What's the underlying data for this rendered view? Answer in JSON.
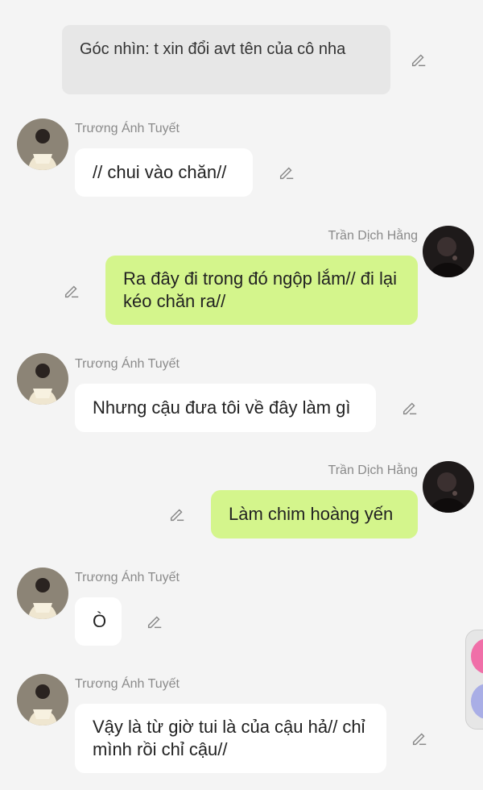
{
  "narration": {
    "text": "Góc nhìn: t xin đổi avt tên của cô nha"
  },
  "messages": [
    {
      "sender": "Trương Ánh Tuyết",
      "text": "// chui vào chăn//"
    },
    {
      "sender": "Trần Dịch Hằng",
      "text": "Ra đây đi trong đó ngộp lắm// đi lại kéo chăn ra//"
    },
    {
      "sender": "Trương Ánh Tuyết",
      "text": "Nhưng cậu đưa tôi về đây làm gì"
    },
    {
      "sender": "Trần Dịch Hằng",
      "text": "Làm chim hoàng yến"
    },
    {
      "sender": "Trương Ánh Tuyết",
      "text": "Ò"
    },
    {
      "sender": "Trương Ánh Tuyết",
      "text": "Vậy là từ giờ tui là của cậu hả// chỉ mình rồi chỉ cậu//"
    }
  ],
  "icons": {
    "edit": "pencil-edit-icon",
    "avatar_left": "avatar-truong-anh-tuyet",
    "avatar_right": "avatar-tran-dich-hang"
  },
  "colors": {
    "background": "#f4f4f4",
    "own_bubble": "#d4f58c",
    "other_bubble": "#ffffff",
    "narration_bubble": "#e7e7e7",
    "name_text": "#8a8a8a"
  }
}
